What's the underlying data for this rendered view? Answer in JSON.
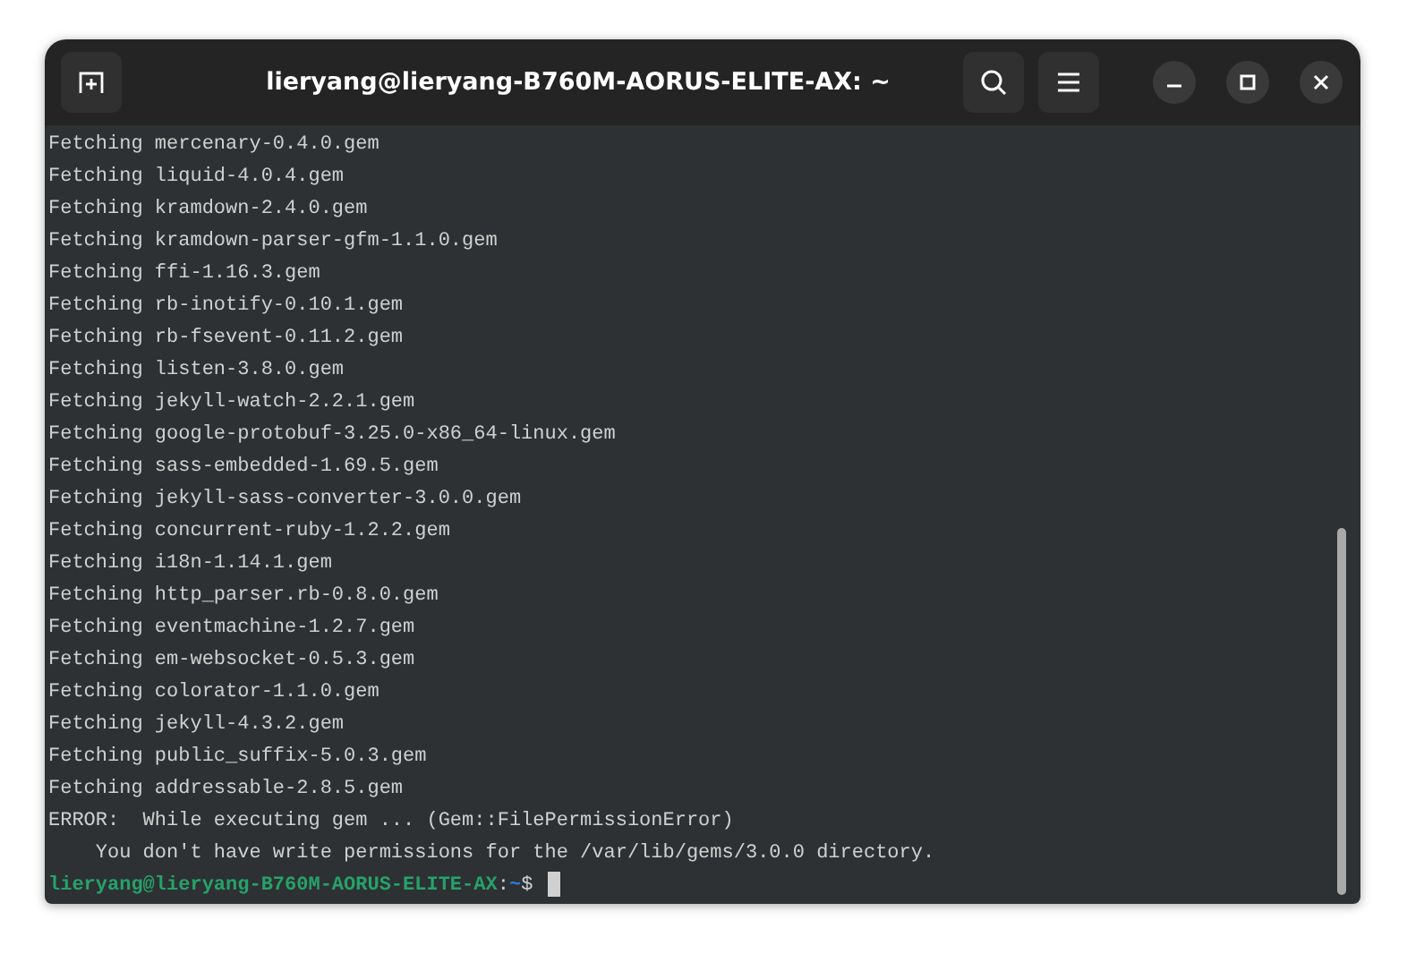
{
  "window": {
    "title": "lieryang@lieryang-B760M-AORUS-ELITE-AX: ~"
  },
  "lines": [
    {
      "kind": "output",
      "text": "Fetching mercenary-0.4.0.gem"
    },
    {
      "kind": "output",
      "text": "Fetching liquid-4.0.4.gem"
    },
    {
      "kind": "output",
      "text": "Fetching kramdown-2.4.0.gem"
    },
    {
      "kind": "output",
      "text": "Fetching kramdown-parser-gfm-1.1.0.gem"
    },
    {
      "kind": "output",
      "text": "Fetching ffi-1.16.3.gem"
    },
    {
      "kind": "output",
      "text": "Fetching rb-inotify-0.10.1.gem"
    },
    {
      "kind": "output",
      "text": "Fetching rb-fsevent-0.11.2.gem"
    },
    {
      "kind": "output",
      "text": "Fetching listen-3.8.0.gem"
    },
    {
      "kind": "output",
      "text": "Fetching jekyll-watch-2.2.1.gem"
    },
    {
      "kind": "output",
      "text": "Fetching google-protobuf-3.25.0-x86_64-linux.gem"
    },
    {
      "kind": "output",
      "text": "Fetching sass-embedded-1.69.5.gem"
    },
    {
      "kind": "output",
      "text": "Fetching jekyll-sass-converter-3.0.0.gem"
    },
    {
      "kind": "output",
      "text": "Fetching concurrent-ruby-1.2.2.gem"
    },
    {
      "kind": "output",
      "text": "Fetching i18n-1.14.1.gem"
    },
    {
      "kind": "output",
      "text": "Fetching http_parser.rb-0.8.0.gem"
    },
    {
      "kind": "output",
      "text": "Fetching eventmachine-1.2.7.gem"
    },
    {
      "kind": "output",
      "text": "Fetching em-websocket-0.5.3.gem"
    },
    {
      "kind": "output",
      "text": "Fetching colorator-1.1.0.gem"
    },
    {
      "kind": "output",
      "text": "Fetching jekyll-4.3.2.gem"
    },
    {
      "kind": "output",
      "text": "Fetching public_suffix-5.0.3.gem"
    },
    {
      "kind": "output",
      "text": "Fetching addressable-2.8.5.gem"
    },
    {
      "kind": "output",
      "text": "ERROR:  While executing gem ... (Gem::FilePermissionError)"
    },
    {
      "kind": "output",
      "text": "    You don't have write permissions for the /var/lib/gems/3.0.0 directory."
    },
    {
      "kind": "prompt",
      "user_host": "lieryang@lieryang-B760M-AORUS-ELITE-AX",
      "separator": ":",
      "path": "~",
      "symbol": "$"
    }
  ]
}
